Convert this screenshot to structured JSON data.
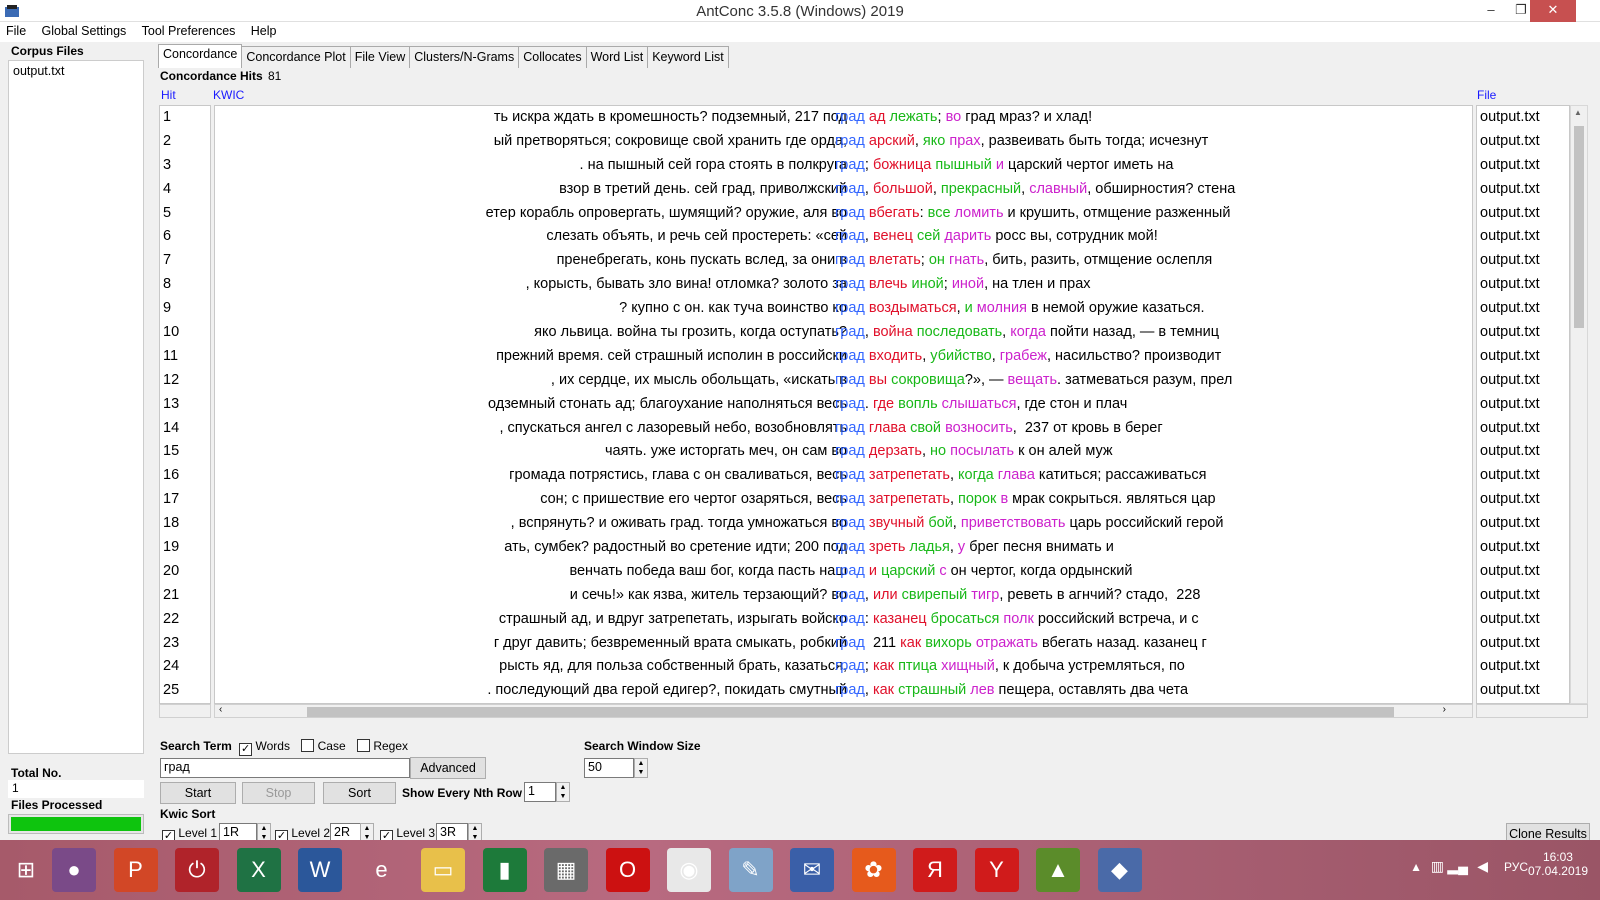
{
  "window": {
    "title": "AntConc 3.5.8 (Windows) 2019",
    "minimize_glyph": "–",
    "restore_glyph": "❐",
    "close_glyph": "✕"
  },
  "menu": [
    "File",
    "Global Settings",
    "Tool Preferences",
    "Help"
  ],
  "left_panel": {
    "corpus_label": "Corpus Files",
    "files": [
      "output.txt"
    ],
    "total_label": "Total No.",
    "total_value": "1",
    "processed_label": "Files Processed",
    "progress": 1.0,
    "progress_color": "#0ec40e"
  },
  "tabs": [
    "Concordance",
    "Concordance Plot",
    "File View",
    "Clusters/N-Grams",
    "Collocates",
    "Word List",
    "Keyword List"
  ],
  "concordance": {
    "hits_label": "Concordance Hits",
    "hits_value": "81",
    "col_hit": "Hit",
    "col_kwic": "KWIC",
    "col_file": "File",
    "rows": [
      {
        "n": "1",
        "left": "ть искра ждать в кромешность? подземный,  217 под",
        "right": [
          [
            "град",
            "n"
          ],
          [
            " ",
            ""
          ],
          [
            "ад",
            "r"
          ],
          [
            " ",
            ""
          ],
          [
            "лежать",
            "g"
          ],
          [
            "; ",
            ""
          ],
          [
            "во",
            "m"
          ],
          [
            " град мраз? и хлад!",
            ""
          ]
        ],
        "file": "output.txt"
      },
      {
        "n": "2",
        "left": "ый претворяться; сокровище свой хранить где орда,",
        "right": [
          [
            "град",
            "n"
          ],
          [
            " ",
            ""
          ],
          [
            "арский",
            "r"
          ],
          [
            ", ",
            ""
          ],
          [
            "яко",
            "g"
          ],
          [
            " ",
            ""
          ],
          [
            "прах",
            "m"
          ],
          [
            ", развеивать быть тогда; исчезнут",
            ""
          ]
        ],
        "file": "output.txt"
      },
      {
        "n": "3",
        "left": ". на пышный сей гора стоять в полкруга",
        "right": [
          [
            "град",
            "n"
          ],
          [
            "; ",
            ""
          ],
          [
            "божница",
            "r"
          ],
          [
            " ",
            ""
          ],
          [
            "пышный",
            "g"
          ],
          [
            " ",
            ""
          ],
          [
            "и",
            "m"
          ],
          [
            " царский чертог иметь на",
            ""
          ]
        ],
        "file": "output.txt"
      },
      {
        "n": "4",
        "left": "взор в третий день.  сей град, приволжский",
        "right": [
          [
            "град",
            "n"
          ],
          [
            ", ",
            ""
          ],
          [
            "большой",
            "r"
          ],
          [
            ", ",
            ""
          ],
          [
            "прекрасный",
            "g"
          ],
          [
            ", ",
            ""
          ],
          [
            "славный",
            "m"
          ],
          [
            ", обширностия? стена",
            ""
          ]
        ],
        "file": "output.txt"
      },
      {
        "n": "5",
        "left": "етер корабль опровергать, шумящий? оружие, аля во",
        "right": [
          [
            "град",
            "n"
          ],
          [
            " ",
            ""
          ],
          [
            "вбегать",
            "r"
          ],
          [
            ": ",
            ""
          ],
          [
            "все",
            "g"
          ],
          [
            " ",
            ""
          ],
          [
            "ломить",
            "m"
          ],
          [
            " и крушить, отмщение разженный",
            ""
          ]
        ],
        "file": "output.txt"
      },
      {
        "n": "6",
        "left": "слезать объять, и речь сей простереть: «сей",
        "right": [
          [
            "град",
            "n"
          ],
          [
            ", ",
            ""
          ],
          [
            "венец",
            "r"
          ],
          [
            " ",
            ""
          ],
          [
            "сей",
            "g"
          ],
          [
            " ",
            ""
          ],
          [
            "дарить",
            "m"
          ],
          [
            " росс вы, сотрудник мой!",
            ""
          ]
        ],
        "file": "output.txt"
      },
      {
        "n": "7",
        "left": "пренебрегать, конь пускать вслед, за они в",
        "right": [
          [
            "град",
            "n"
          ],
          [
            " ",
            ""
          ],
          [
            "влетать",
            "r"
          ],
          [
            "; ",
            ""
          ],
          [
            "он",
            "g"
          ],
          [
            " ",
            ""
          ],
          [
            "гнать",
            "m"
          ],
          [
            ", бить, разить, отмщение ослепля",
            ""
          ]
        ],
        "file": "output.txt"
      },
      {
        "n": "8",
        "left": ", корысть, бывать зло вина! отломка? золото за",
        "right": [
          [
            "град",
            "n"
          ],
          [
            " ",
            ""
          ],
          [
            "влечь",
            "r"
          ],
          [
            " ",
            ""
          ],
          [
            "иной",
            "g"
          ],
          [
            "; ",
            ""
          ],
          [
            "иной",
            "m"
          ],
          [
            ", на тлен и прах",
            ""
          ]
        ],
        "file": "output.txt"
      },
      {
        "n": "9",
        "left": "? купно с он. как туча воинство ко",
        "right": [
          [
            "град",
            "n"
          ],
          [
            " ",
            ""
          ],
          [
            "воздыматься",
            "r"
          ],
          [
            ", ",
            ""
          ],
          [
            "и",
            "g"
          ],
          [
            " ",
            ""
          ],
          [
            "молния",
            "m"
          ],
          [
            " в немой оружие казаться.",
            ""
          ]
        ],
        "file": "output.txt"
      },
      {
        "n": "10",
        "left": "яко львица. война ты грозить, когда оступать?",
        "right": [
          [
            "град",
            "n"
          ],
          [
            ", ",
            ""
          ],
          [
            "война",
            "r"
          ],
          [
            " ",
            ""
          ],
          [
            "последовать",
            "g"
          ],
          [
            ", ",
            ""
          ],
          [
            "когда",
            "m"
          ],
          [
            " пойти назад, — в темниц",
            ""
          ]
        ],
        "file": "output.txt"
      },
      {
        "n": "11",
        "left": "прежний время. сей страшный исполин в российски",
        "right": [
          [
            "град",
            "n"
          ],
          [
            " ",
            ""
          ],
          [
            "входить",
            "r"
          ],
          [
            ", ",
            ""
          ],
          [
            "убийство",
            "g"
          ],
          [
            ", ",
            ""
          ],
          [
            "грабеж",
            "m"
          ],
          [
            ", насильство? производит",
            ""
          ]
        ],
        "file": "output.txt"
      },
      {
        "n": "12",
        "left": ", их сердце, их мысль обольщать, «искать в",
        "right": [
          [
            "град",
            "n"
          ],
          [
            " ",
            ""
          ],
          [
            "вы",
            "r"
          ],
          [
            " ",
            ""
          ],
          [
            "сокровища",
            "g"
          ],
          [
            "?», — ",
            ""
          ],
          [
            "вещать",
            "m"
          ],
          [
            ". затмеваться разум, прел",
            ""
          ]
        ],
        "file": "output.txt"
      },
      {
        "n": "13",
        "left": "одземный стонать ад; благоухание наполняться весь",
        "right": [
          [
            "град",
            "n"
          ],
          [
            ". ",
            ""
          ],
          [
            "где",
            "r"
          ],
          [
            " ",
            ""
          ],
          [
            "вопль",
            "g"
          ],
          [
            " ",
            ""
          ],
          [
            "слышаться",
            "m"
          ],
          [
            ", где стон и плач",
            ""
          ]
        ],
        "file": "output.txt"
      },
      {
        "n": "14",
        "left": ", спускаться ангел с лазоревый небо, возобновлять",
        "right": [
          [
            "град",
            "n"
          ],
          [
            " ",
            ""
          ],
          [
            "глава",
            "r"
          ],
          [
            " ",
            ""
          ],
          [
            "свой",
            "g"
          ],
          [
            " ",
            ""
          ],
          [
            "возносить",
            "m"
          ],
          [
            ",  237 от кровь в берег",
            ""
          ]
        ],
        "file": "output.txt"
      },
      {
        "n": "15",
        "left": "чаять. уже исторгать меч, он сам во",
        "right": [
          [
            "град",
            "n"
          ],
          [
            " ",
            ""
          ],
          [
            "дерзать",
            "r"
          ],
          [
            ", ",
            ""
          ],
          [
            "но",
            "g"
          ],
          [
            " ",
            ""
          ],
          [
            "посылать",
            "m"
          ],
          [
            " к он алей муж",
            ""
          ]
        ],
        "file": "output.txt"
      },
      {
        "n": "16",
        "left": "громада потрястись, глава с он сваливаться, весь",
        "right": [
          [
            "град",
            "n"
          ],
          [
            " ",
            ""
          ],
          [
            "затрепетать",
            "r"
          ],
          [
            ", ",
            ""
          ],
          [
            "когда",
            "g"
          ],
          [
            " ",
            ""
          ],
          [
            "глава",
            "m"
          ],
          [
            " катиться; рассаживаться",
            ""
          ]
        ],
        "file": "output.txt"
      },
      {
        "n": "17",
        "left": "сон; с пришествие его чертог озаряться, весь",
        "right": [
          [
            "град",
            "n"
          ],
          [
            " ",
            ""
          ],
          [
            "затрепетать",
            "r"
          ],
          [
            ", ",
            ""
          ],
          [
            "порок",
            "g"
          ],
          [
            " ",
            ""
          ],
          [
            "в",
            "m"
          ],
          [
            " мрак сокрыться. являться цар",
            ""
          ]
        ],
        "file": "output.txt"
      },
      {
        "n": "18",
        "left": ", вспрянуть? и оживать град.  тогда умножаться во",
        "right": [
          [
            "град",
            "n"
          ],
          [
            " ",
            ""
          ],
          [
            "звучный",
            "r"
          ],
          [
            " ",
            ""
          ],
          [
            "бой",
            "g"
          ],
          [
            ", ",
            ""
          ],
          [
            "приветствовать",
            "m"
          ],
          [
            " царь российский герой",
            ""
          ]
        ],
        "file": "output.txt"
      },
      {
        "n": "19",
        "left": "ать, сумбек? радостный во сретение идти;  200 под",
        "right": [
          [
            "град",
            "n"
          ],
          [
            " ",
            ""
          ],
          [
            "зреть",
            "r"
          ],
          [
            " ",
            ""
          ],
          [
            "ладья",
            "g"
          ],
          [
            ", ",
            ""
          ],
          [
            "у",
            "m"
          ],
          [
            " брег песня внимать и",
            ""
          ]
        ],
        "file": "output.txt"
      },
      {
        "n": "20",
        "left": "венчать победа ваш бог, когда пасть наш",
        "right": [
          [
            "град",
            "n"
          ],
          [
            " ",
            ""
          ],
          [
            "и",
            "r"
          ],
          [
            " ",
            ""
          ],
          [
            "царский",
            "g"
          ],
          [
            " ",
            ""
          ],
          [
            "с",
            "m"
          ],
          [
            " он чертог, когда ордынский",
            ""
          ]
        ],
        "file": "output.txt"
      },
      {
        "n": "21",
        "left": "и сечь!» как язва, житель терзающий? во",
        "right": [
          [
            "град",
            "n"
          ],
          [
            ", ",
            ""
          ],
          [
            "или",
            "r"
          ],
          [
            " ",
            ""
          ],
          [
            "свирепый",
            "g"
          ],
          [
            " ",
            ""
          ],
          [
            "тигр",
            "m"
          ],
          [
            ", реветь в агнчий? стадо,  228",
            ""
          ]
        ],
        "file": "output.txt"
      },
      {
        "n": "22",
        "left": "страшный ад, и вдруг затрепетать, изрыгать войско",
        "right": [
          [
            "град",
            "n"
          ],
          [
            ": ",
            ""
          ],
          [
            "казанец",
            "r"
          ],
          [
            " ",
            ""
          ],
          [
            "бросаться",
            "g"
          ],
          [
            " ",
            ""
          ],
          [
            "полк",
            "m"
          ],
          [
            " российский встреча, и с",
            ""
          ]
        ],
        "file": "output.txt"
      },
      {
        "n": "23",
        "left": "г друг давить; безвременный врата смыкать, робкий",
        "right": [
          [
            "град",
            "n"
          ],
          [
            "  211 ",
            ""
          ],
          [
            "как",
            "r"
          ],
          [
            " ",
            ""
          ],
          [
            "вихорь",
            "g"
          ],
          [
            " ",
            ""
          ],
          [
            "отражать",
            "m"
          ],
          [
            " вбегать назад. казанец г",
            ""
          ]
        ],
        "file": "output.txt"
      },
      {
        "n": "24",
        "left": "рысть яд, для польза собственный брать, казаться,",
        "right": [
          [
            "град",
            "n"
          ],
          [
            "; ",
            ""
          ],
          [
            "как",
            "r"
          ],
          [
            " ",
            ""
          ],
          [
            "птица",
            "g"
          ],
          [
            " ",
            ""
          ],
          [
            "хищный",
            "m"
          ],
          [
            ", к добыча устремляться, по",
            ""
          ]
        ],
        "file": "output.txt"
      },
      {
        "n": "25",
        "left": ". последующий два герой едигер?, покидать смутный",
        "right": [
          [
            "град",
            "n"
          ],
          [
            ", ",
            ""
          ],
          [
            "как",
            "r"
          ],
          [
            " ",
            ""
          ],
          [
            "страшный",
            "g"
          ],
          [
            " ",
            ""
          ],
          [
            "лев",
            "m"
          ],
          [
            " пещера, оставлять два чета",
            ""
          ]
        ],
        "file": "output.txt"
      }
    ]
  },
  "search": {
    "term_label": "Search Term",
    "words_label": "Words",
    "words_checked": true,
    "case_label": "Case",
    "case_checked": false,
    "regex_label": "Regex",
    "regex_checked": false,
    "term_value": "град",
    "advanced_label": "Advanced",
    "window_label": "Search Window Size",
    "window_value": "50",
    "start_label": "Start",
    "stop_label": "Stop",
    "sort_label": "Sort",
    "nth_label": "Show Every Nth Row",
    "nth_value": "1"
  },
  "kwic_sort": {
    "label": "Kwic Sort",
    "level1_label": "Level 1",
    "level1_value": "1R",
    "level1_checked": true,
    "level2_label": "Level 2",
    "level2_value": "2R",
    "level2_checked": true,
    "level3_label": "Level 3",
    "level3_value": "3R",
    "level3_checked": true,
    "clone_label": "Clone Results"
  },
  "taskbar": {
    "icons": [
      "windows-start-icon",
      "cortana-mic-icon",
      "powerpoint-icon",
      "power-icon",
      "excel-icon",
      "word-icon",
      "internet-explorer-icon",
      "file-explorer-icon",
      "book-icon",
      "calculator-icon",
      "opera-icon",
      "chrome-icon",
      "paint-icon",
      "mail-icon",
      "media-icon",
      "yandex-icon",
      "yandex-browser-icon",
      "chart-app-icon",
      "antconc-icon"
    ],
    "lang": "РУС",
    "time": "16:03",
    "date": "07.04.2019"
  }
}
